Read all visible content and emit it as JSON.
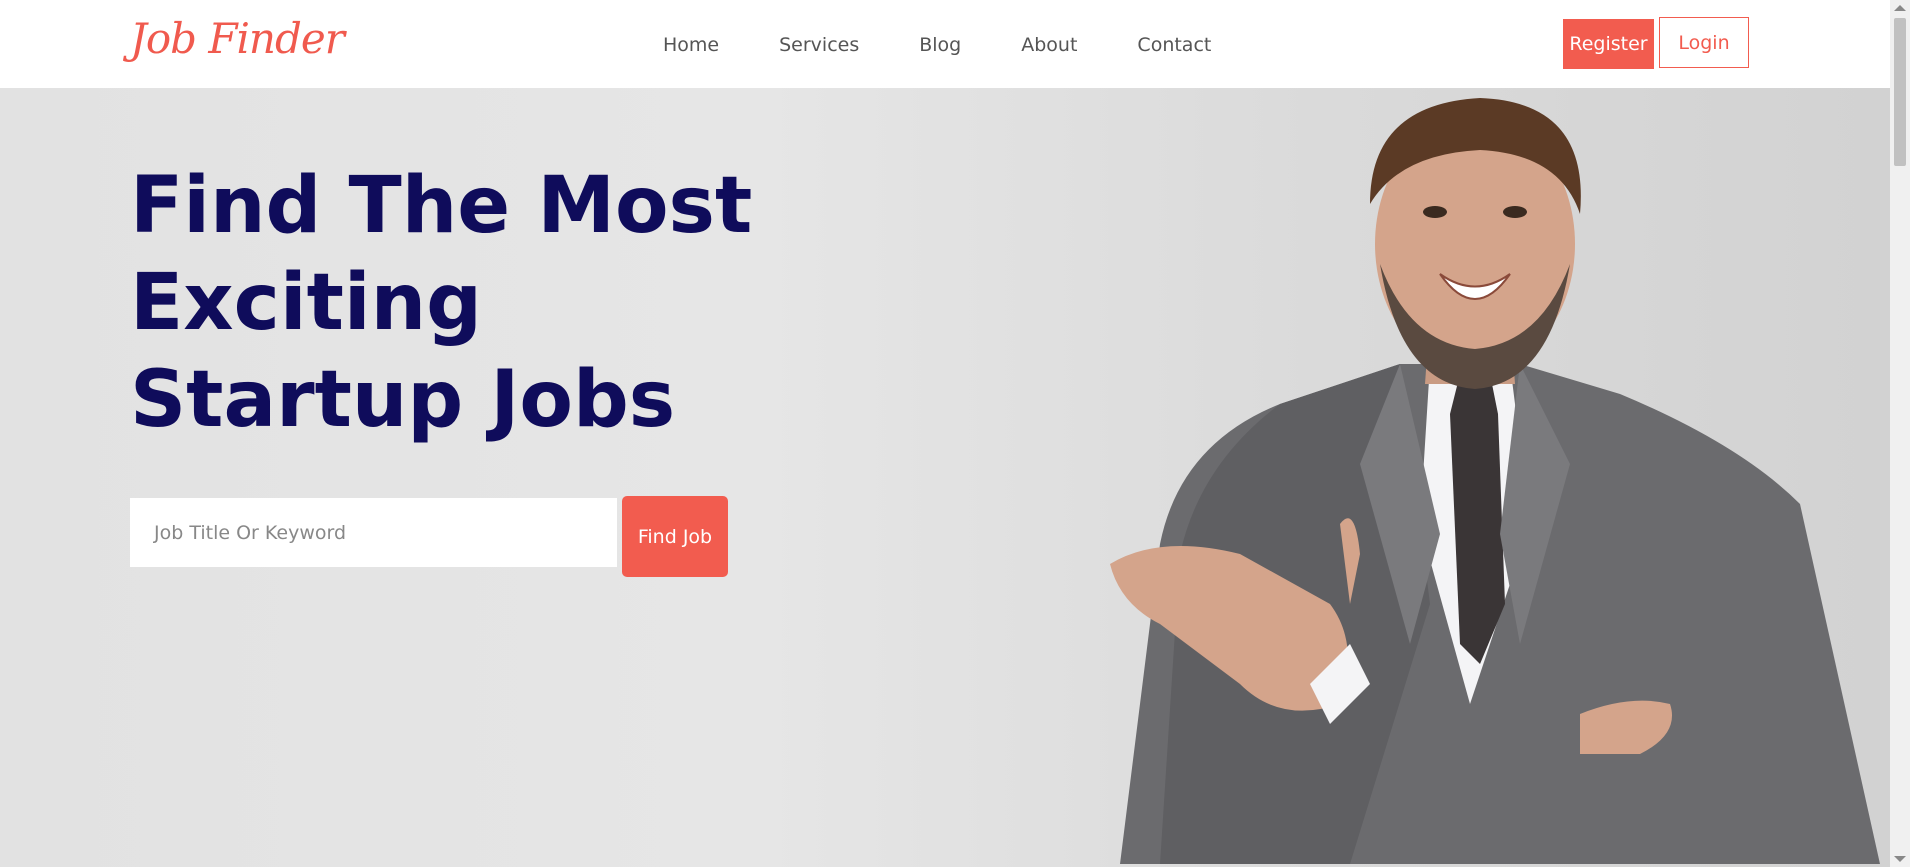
{
  "header": {
    "logo": "Job Finder",
    "nav": [
      "Home",
      "Services",
      "Blog",
      "About",
      "Contact"
    ],
    "register_label": "Register",
    "login_label": "Login"
  },
  "hero": {
    "headline_lines": [
      "Find The Most",
      "Exciting",
      "Startup Jobs"
    ],
    "search_placeholder": "Job Title Or Keyword",
    "find_button": "Find Job"
  },
  "colors": {
    "accent": "#f25c4f",
    "headline": "#0f0c5b"
  }
}
